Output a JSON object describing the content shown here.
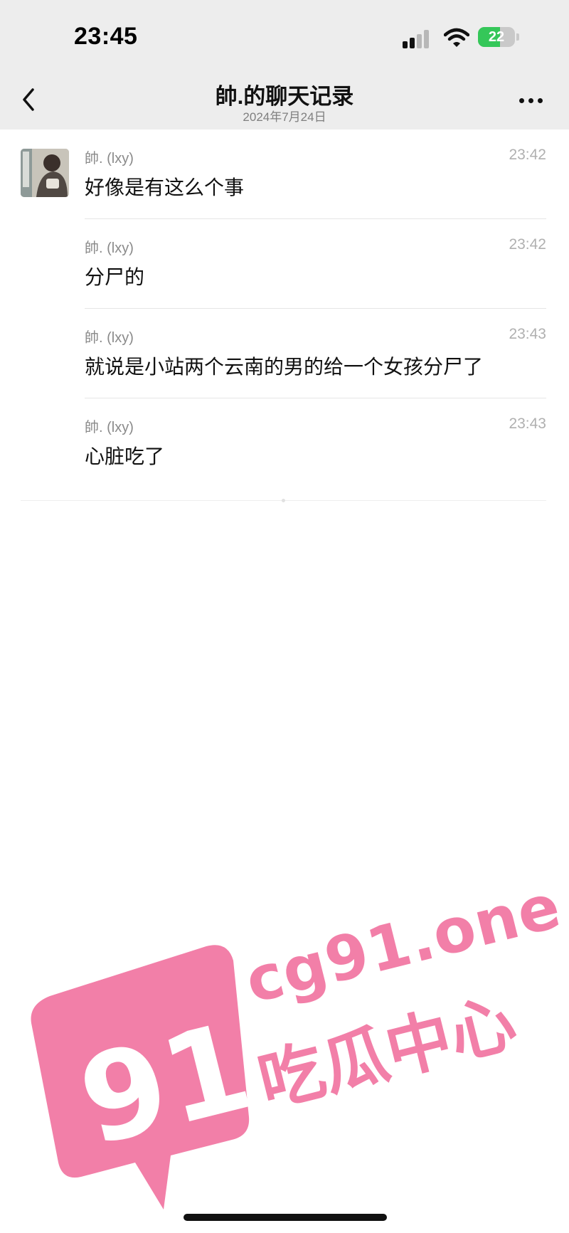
{
  "status_bar": {
    "time": "23:45",
    "signal_icon": "cellular-signal-icon",
    "wifi_icon": "wifi-icon",
    "battery_level": "22",
    "battery_fraction": 0.22,
    "battery_color": "#35c759"
  },
  "nav": {
    "back_icon": "chevron-left-icon",
    "title": "帥.的聊天记录",
    "subtitle": "2024年7月24日",
    "more_icon": "more-horizontal-icon"
  },
  "messages": [
    {
      "sender": "帥. (lxy)",
      "time": "23:42",
      "text": "好像是有这么个事",
      "show_avatar": true
    },
    {
      "sender": "帥. (lxy)",
      "time": "23:42",
      "text": "分尸的",
      "show_avatar": false
    },
    {
      "sender": "帥. (lxy)",
      "time": "23:43",
      "text": "就说是小站两个云南的男的给一个女孩分尸了",
      "show_avatar": false
    },
    {
      "sender": "帥. (lxy)",
      "time": "23:43",
      "text": "心脏吃了",
      "show_avatar": false
    }
  ],
  "watermark": {
    "logo_text": "91",
    "site": "cg91.one",
    "slogan": "吃瓜中心",
    "color": "#f27fa8"
  }
}
